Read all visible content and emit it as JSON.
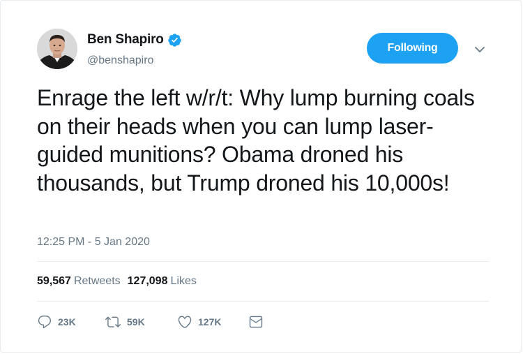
{
  "author": {
    "display_name": "Ben Shapiro",
    "handle": "@benshapiro",
    "verified": true,
    "avatar_icon": "profile-photo"
  },
  "follow_button": {
    "label": "Following"
  },
  "tweet": {
    "text": "Enrage the left w/r/t: Why lump burning coals on their heads when you can lump laser-guided munitions? Obama droned his thousands, but Trump droned his 10,000s!",
    "timestamp": "12:25 PM - 5 Jan 2020"
  },
  "stats": {
    "retweets_count": "59,567",
    "retweets_label": "Retweets",
    "likes_count": "127,098",
    "likes_label": "Likes"
  },
  "actions": {
    "reply_count": "23K",
    "retweet_count": "59K",
    "like_count": "127K"
  },
  "colors": {
    "accent": "#1da1f2",
    "secondary_text": "#657786",
    "primary_text": "#14171a",
    "divider": "#e6ecf0"
  }
}
